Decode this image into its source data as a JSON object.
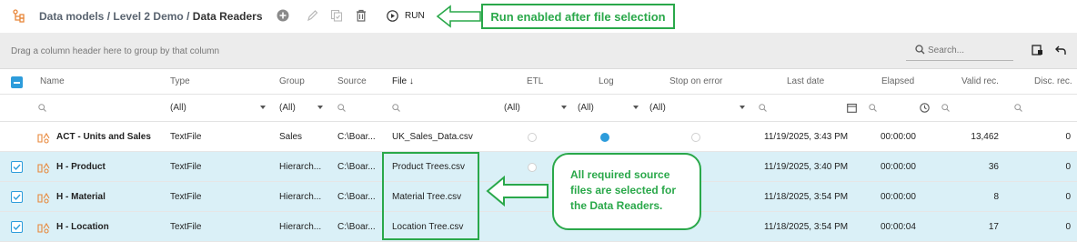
{
  "toolbar": {
    "breadcrumb": [
      "Data models",
      "Level 2 Demo",
      "Data Readers"
    ],
    "separator": "/",
    "run_label": "RUN",
    "icons": [
      "data-model-icon",
      "add-icon",
      "edit-icon",
      "copy-icon",
      "delete-icon",
      "play-icon"
    ]
  },
  "groupbar": {
    "hint": "Drag a column header here to group by that column",
    "search_placeholder": "Search..."
  },
  "columns": [
    "Name",
    "Type",
    "Group",
    "Source",
    "File ↓",
    "ETL",
    "Log",
    "Stop on error",
    "Last date",
    "Elapsed",
    "Valid rec.",
    "Disc. rec."
  ],
  "filters": {
    "type": "(All)",
    "group": "(All)",
    "etl": "(All)",
    "log": "(All)",
    "stop": "(All)"
  },
  "rows": [
    {
      "selected": false,
      "name": "ACT - Units and Sales",
      "type": "TextFile",
      "group": "Sales",
      "source": "C:\\Boar...",
      "file": "UK_Sales_Data.csv",
      "log_on": true,
      "last_date": "11/19/2025, 3:43 PM",
      "elapsed": "00:00:00",
      "valid": "13,462",
      "disc": "0"
    },
    {
      "selected": true,
      "name": "H - Product",
      "type": "TextFile",
      "group": "Hierarch...",
      "source": "C:\\Boar...",
      "file": "Product Trees.csv",
      "log_on": false,
      "last_date": "11/19/2025, 3:40 PM",
      "elapsed": "00:00:00",
      "valid": "36",
      "disc": "0"
    },
    {
      "selected": true,
      "name": "H - Material",
      "type": "TextFile",
      "group": "Hierarch...",
      "source": "C:\\Boar...",
      "file": "Material Tree.csv",
      "log_on": false,
      "last_date": "11/18/2025, 3:54 PM",
      "elapsed": "00:00:00",
      "valid": "8",
      "disc": "0"
    },
    {
      "selected": true,
      "name": "H - Location",
      "type": "TextFile",
      "group": "Hierarch...",
      "source": "C:\\Boar...",
      "file": "Location Tree.csv",
      "log_on": false,
      "last_date": "11/18/2025, 3:54 PM",
      "elapsed": "00:00:04",
      "valid": "17",
      "disc": "0"
    }
  ],
  "annotations": {
    "run_note": "Run enabled after file selection",
    "files_note": [
      "All required source",
      "files are selected for",
      "the Data Readers."
    ]
  },
  "colors": {
    "accent_green": "#2aa84a",
    "selection_blue": "#daf0f7",
    "brand_blue": "#2d9cdb",
    "icon_orange": "#e8873a"
  }
}
